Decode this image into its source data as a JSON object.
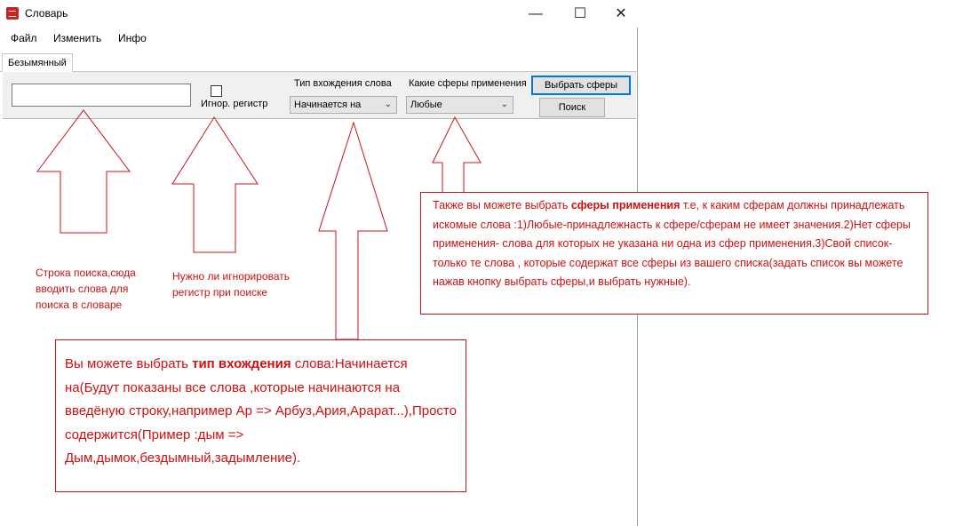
{
  "window": {
    "title": "Словарь",
    "controls": {
      "minimize": "—",
      "maximize": "☐",
      "close": "✕"
    }
  },
  "menu": [
    "Файл",
    "Изменить",
    "Инфо"
  ],
  "tab": {
    "label": "Безымянный"
  },
  "toolbar": {
    "search_value": "",
    "ignore_case_label": "Игнор. регистр",
    "entry_type_label": "Тип вхождения слова",
    "entry_type_value": "Начинается на",
    "spheres_label": "Какие сферы применения",
    "spheres_value": "Любые",
    "choose_spheres_button": "Выбрать сферы",
    "search_button": "Поиск"
  },
  "annotations": {
    "search_note": "Строка поиска,сюда вводить слова для поиска в словаре",
    "case_note": "Нужно ли игнорировать регистр при поиске",
    "spheres_note": {
      "p1": "Также вы можете выбрать ",
      "bold": "сферы применения",
      "p2": " т.е, к каким сферам должны принадлежать искомые слова :1)Любые-принадлежнасть к сфере/сферам не имеет значения.2)Нет сферы применения- слова для которых не указана ни одна из сфер применения.3)Свой список- только те слова , которые содержат  все сферы из вашего списка(задать список вы можете нажав кнопку выбрать сферы,и выбрать нужные)."
    },
    "entry_note": {
      "p1": "Вы можете выбрать ",
      "bold": "тип вхождения",
      "p2": " слова:Начинается на(Будут показаны все слова ,которые начинаются на введёную строку,например Ар => Арбуз,Ария,Арарат...),Просто содержится(Пример :дым => Дым,дымок,бездымный,задымление)."
    }
  },
  "colors": {
    "annotation": "#d01010",
    "focus_border": "#0078d7"
  }
}
